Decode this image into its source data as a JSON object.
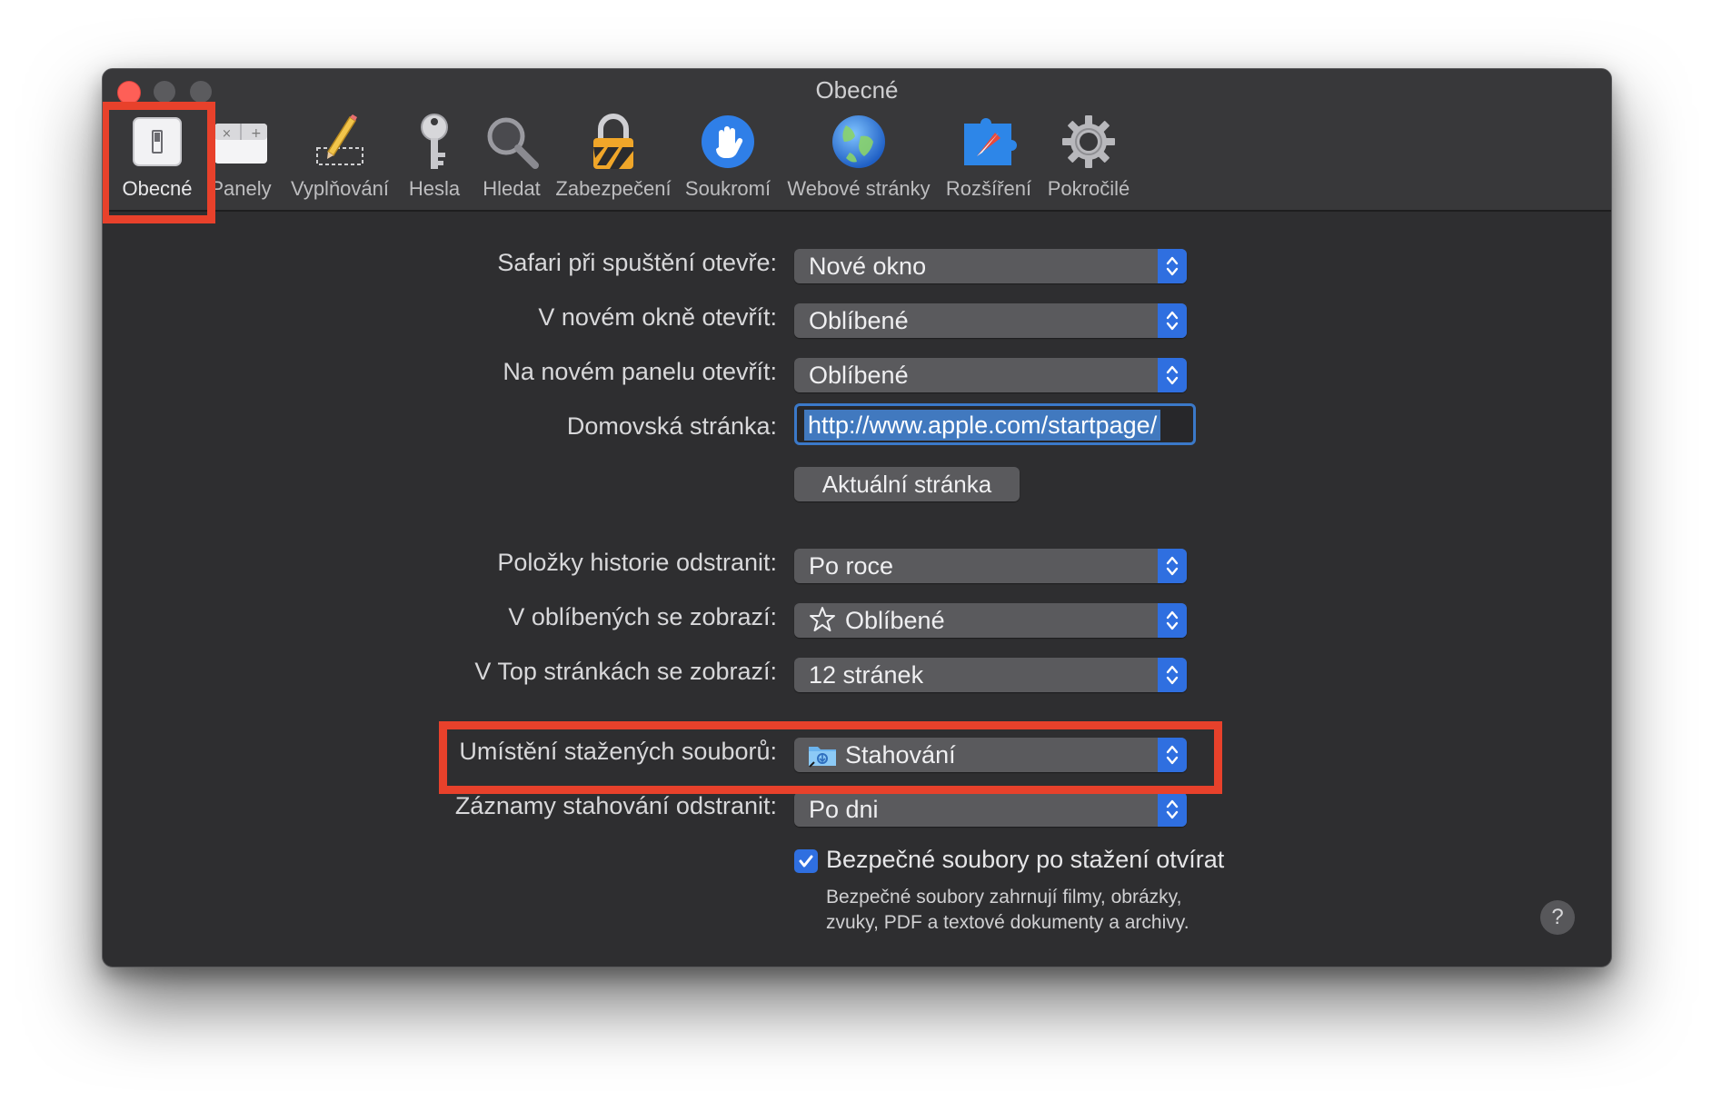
{
  "window": {
    "title": "Obecné"
  },
  "toolbar": {
    "items": [
      {
        "label": "Obecné",
        "icon": "general-switch-icon"
      },
      {
        "label": "Panely",
        "icon": "tabs-icon"
      },
      {
        "label": "Vyplňování",
        "icon": "autofill-pencil-icon"
      },
      {
        "label": "Hesla",
        "icon": "key-icon"
      },
      {
        "label": "Hledat",
        "icon": "magnifier-icon"
      },
      {
        "label": "Zabezpečení",
        "icon": "padlock-icon"
      },
      {
        "label": "Soukromí",
        "icon": "privacy-hand-icon"
      },
      {
        "label": "Webové stránky",
        "icon": "globe-icon"
      },
      {
        "label": "Rozšíření",
        "icon": "extensions-puzzle-icon"
      },
      {
        "label": "Pokročilé",
        "icon": "gear-icon"
      }
    ],
    "selected": "Obecné"
  },
  "settings": {
    "safari_opens": {
      "label": "Safari při spuštění otevře:",
      "value": "Nové okno"
    },
    "new_window": {
      "label": "V novém okně otevřít:",
      "value": "Oblíbené"
    },
    "new_tab": {
      "label": "Na novém panelu otevřít:",
      "value": "Oblíbené"
    },
    "homepage": {
      "label": "Domovská stránka:",
      "value": "http://www.apple.com/startpage/"
    },
    "current_page_button": "Aktuální stránka",
    "history_remove": {
      "label": "Položky historie odstranit:",
      "value": "Po roce"
    },
    "favorites_show": {
      "label": "V oblíbených se zobrazí:",
      "value": "Oblíbené",
      "icon": "star-outline-icon"
    },
    "top_sites": {
      "label": "V Top stránkách se zobrazí:",
      "value": "12 stránek"
    },
    "download_location": {
      "label": "Umístění stažených souborů:",
      "value": "Stahování",
      "icon": "downloads-folder-icon"
    },
    "download_remove": {
      "label": "Záznamy stahování odstranit:",
      "value": "Po dni"
    },
    "open_safe_files": {
      "label": "Bezpečné soubory po stažení otvírat",
      "checked": true,
      "description_line1": "Bezpečné soubory zahrnují filmy, obrázky,",
      "description_line2": "zvuky, PDF a textové dokumenty a archivy."
    },
    "help_label": "?"
  },
  "colors": {
    "highlight_red": "#e8412b",
    "accent_blue": "#2f6fe0",
    "window_bg": "#2e2e30"
  }
}
